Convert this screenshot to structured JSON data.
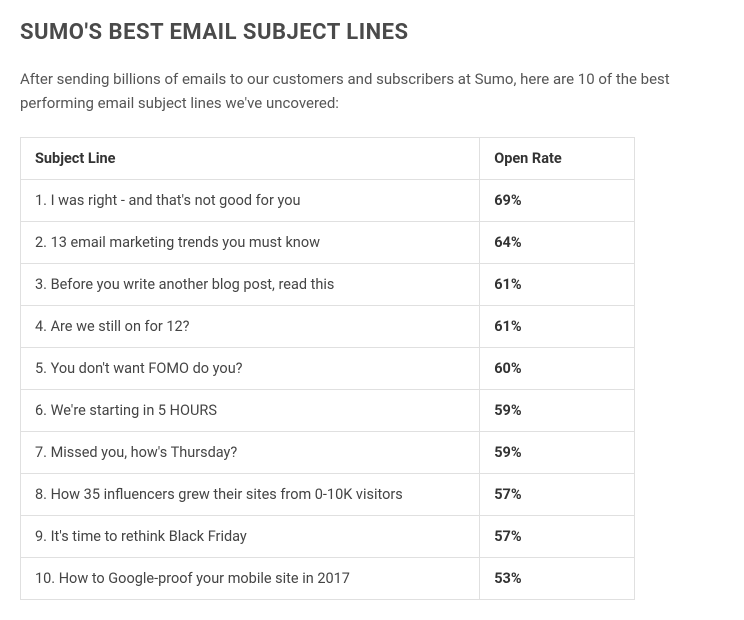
{
  "heading": "SUMO'S BEST EMAIL SUBJECT LINES",
  "intro": "After sending billions of emails to our customers and subscribers at Sumo, here are 10 of the best performing email subject lines we've uncovered:",
  "chart_data": {
    "type": "table",
    "columns": [
      "Subject Line",
      "Open Rate"
    ],
    "rows": [
      {
        "subject": "1. I was right - and that's not good for you",
        "rate": "69%"
      },
      {
        "subject": "2. 13 email marketing trends you must know",
        "rate": "64%"
      },
      {
        "subject": "3. Before you write another blog post, read this",
        "rate": "61%"
      },
      {
        "subject": "4. Are we still on for 12?",
        "rate": "61%"
      },
      {
        "subject": "5. You don't want FOMO do you?",
        "rate": "60%"
      },
      {
        "subject": "6. We're starting in 5 HOURS",
        "rate": "59%"
      },
      {
        "subject": "7. Missed you, how's Thursday?",
        "rate": "59%"
      },
      {
        "subject": "8. How 35 influencers grew their sites from 0-10K visitors",
        "rate": "57%"
      },
      {
        "subject": "9. It's time to rethink Black Friday",
        "rate": "57%"
      },
      {
        "subject": "10. How to Google-proof your mobile site in 2017",
        "rate": "53%"
      }
    ]
  }
}
